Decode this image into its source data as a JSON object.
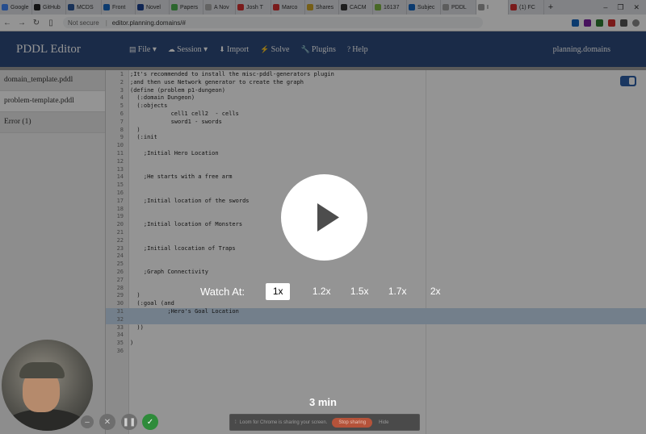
{
  "browser": {
    "tabs": [
      {
        "label": "Google",
        "color": "#4285f4"
      },
      {
        "label": "GitHub",
        "color": "#222222"
      },
      {
        "label": "MCDS",
        "color": "#2b5797"
      },
      {
        "label": "Front",
        "color": "#1565c0"
      },
      {
        "label": "Novel",
        "color": "#1a3f8f"
      },
      {
        "label": "Papers",
        "color": "#4caf50"
      },
      {
        "label": "A Nov",
        "color": "#aaaaaa"
      },
      {
        "label": "Josh T",
        "color": "#d32f2f"
      },
      {
        "label": "Marco",
        "color": "#d32f2f"
      },
      {
        "label": "Shares",
        "color": "#c9a227"
      },
      {
        "label": "CACM",
        "color": "#333333"
      },
      {
        "label": "16137",
        "color": "#7cb342"
      },
      {
        "label": "Subjec",
        "color": "#1565c0"
      },
      {
        "label": "PDDL",
        "color": "#9e9e9e"
      },
      {
        "label": "I",
        "color": "#9e9e9e",
        "active": true
      },
      {
        "label": "(1) FC",
        "color": "#d32f2f"
      }
    ],
    "new_tab": "+",
    "security": "Not secure",
    "url": "editor.planning.domains/#"
  },
  "app": {
    "brand": "PDDL Editor",
    "menu": [
      {
        "icon": "file-icon",
        "label": "File ▾"
      },
      {
        "icon": "cloud-icon",
        "label": "Session ▾"
      },
      {
        "icon": "import-icon",
        "label": "Import"
      },
      {
        "icon": "bolt-icon",
        "label": "Solve"
      },
      {
        "icon": "wrench-icon",
        "label": "Plugins"
      },
      {
        "icon": "help-icon",
        "label": "Help"
      }
    ],
    "site": "planning.domains"
  },
  "files": [
    {
      "label": "domain_template.pddl"
    },
    {
      "label": "problem-template.pddl",
      "selected": true
    },
    {
      "label": "Error (1)"
    }
  ],
  "code": [
    {
      "n": "1",
      "t": ";It's recommended to install the misc-pddl-generators plugin",
      "c": "cmt"
    },
    {
      "n": "2",
      "t": ";and then use Network generator to create the graph",
      "c": "cmt"
    },
    {
      "n": "3",
      "t": "(define (problem p1-dungeon)",
      "c": ""
    },
    {
      "n": "4",
      "t": "  (:domain Dungeon)",
      "c": ""
    },
    {
      "n": "5",
      "t": "  (:objects",
      "c": "kw"
    },
    {
      "n": "6",
      "t": "            cell1 cell2  - cells",
      "c": ""
    },
    {
      "n": "7",
      "t": "            sword1 - swords",
      "c": ""
    },
    {
      "n": "8",
      "t": "  )",
      "c": ""
    },
    {
      "n": "9",
      "t": "  (:init",
      "c": "kw"
    },
    {
      "n": "10",
      "t": "",
      "c": ""
    },
    {
      "n": "11",
      "t": "    ;Initial Hero Location",
      "c": "cmt"
    },
    {
      "n": "12",
      "t": "",
      "c": ""
    },
    {
      "n": "13",
      "t": "",
      "c": ""
    },
    {
      "n": "14",
      "t": "    ;He starts with a free arm",
      "c": "cmt"
    },
    {
      "n": "15",
      "t": "",
      "c": ""
    },
    {
      "n": "16",
      "t": "",
      "c": ""
    },
    {
      "n": "17",
      "t": "    ;Initial location of the swords",
      "c": "cmt"
    },
    {
      "n": "18",
      "t": "",
      "c": ""
    },
    {
      "n": "19",
      "t": "",
      "c": ""
    },
    {
      "n": "20",
      "t": "    ;Initial location of Monsters",
      "c": "cmt"
    },
    {
      "n": "21",
      "t": "",
      "c": ""
    },
    {
      "n": "22",
      "t": "",
      "c": ""
    },
    {
      "n": "23",
      "t": "    ;Initial lcocation of Traps",
      "c": "cmt"
    },
    {
      "n": "24",
      "t": "",
      "c": ""
    },
    {
      "n": "25",
      "t": "",
      "c": ""
    },
    {
      "n": "26",
      "t": "    ;Graph Connectivity",
      "c": "cmt"
    },
    {
      "n": "27",
      "t": "",
      "c": ""
    },
    {
      "n": "28",
      "t": "",
      "c": ""
    },
    {
      "n": "29",
      "t": "  )",
      "c": ""
    },
    {
      "n": "30",
      "t": "  (:goal (and",
      "c": "kw"
    },
    {
      "n": "31",
      "t": "           ;Hero's Goal Location",
      "c": "cmt",
      "hl": true
    },
    {
      "n": "32",
      "t": "",
      "c": "",
      "hl": true
    },
    {
      "n": "33",
      "t": "  ))",
      "c": ""
    },
    {
      "n": "34",
      "t": "",
      "c": ""
    },
    {
      "n": "35",
      "t": ")",
      "c": ""
    },
    {
      "n": "36",
      "t": "",
      "c": ""
    }
  ],
  "player": {
    "watch_label": "Watch At:",
    "speeds": [
      {
        "label": "1x",
        "active": true
      },
      {
        "label": "1.2x"
      },
      {
        "label": "1.5x"
      },
      {
        "label": "1.7x"
      },
      {
        "label": "2x"
      }
    ],
    "duration": "3 min"
  },
  "sharing": {
    "message": "Loom for Chrome is sharing your screen.",
    "stop_label": "Stop sharing",
    "hide_label": "Hide"
  }
}
